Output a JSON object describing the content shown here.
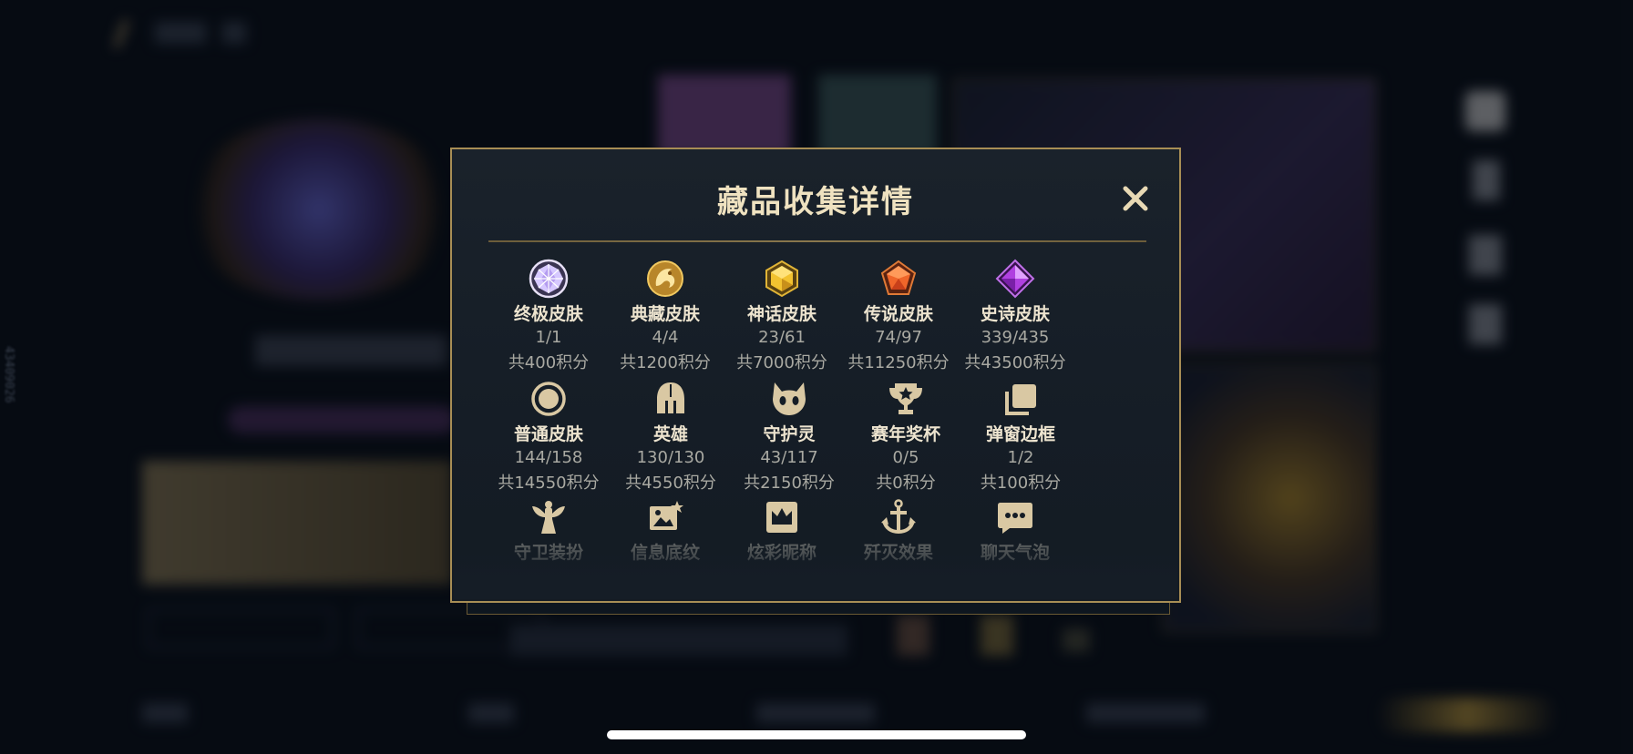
{
  "side_id": "43409026",
  "modal": {
    "title": "藏品收集详情",
    "close_label": "✕"
  },
  "colors": {
    "modal_border": "#a88e55",
    "title": "#efe2c0",
    "label": "#ede4cf",
    "muted": "#a9a9a2",
    "icon_beige": "#d9c8a3"
  },
  "categories": [
    {
      "name": "终极皮肤",
      "count": "1/1",
      "points": "共400积分",
      "icon": "ultimate-gem-icon"
    },
    {
      "name": "典藏皮肤",
      "count": "4/4",
      "points": "共1200积分",
      "icon": "dragon-emblem-icon"
    },
    {
      "name": "神话皮肤",
      "count": "23/61",
      "points": "共7000积分",
      "icon": "mythic-gem-icon"
    },
    {
      "name": "传说皮肤",
      "count": "74/97",
      "points": "共11250积分",
      "icon": "legendary-gem-icon"
    },
    {
      "name": "史诗皮肤",
      "count": "339/435",
      "points": "共43500积分",
      "icon": "epic-gem-icon"
    },
    {
      "name": "普通皮肤",
      "count": "144/158",
      "points": "共14550积分",
      "icon": "circle-icon"
    },
    {
      "name": "英雄",
      "count": "130/130",
      "points": "共4550积分",
      "icon": "helmet-icon"
    },
    {
      "name": "守护灵",
      "count": "43/117",
      "points": "共2150积分",
      "icon": "little-legend-icon"
    },
    {
      "name": "赛年奖杯",
      "count": "0/5",
      "points": "共0积分",
      "icon": "trophy-icon"
    },
    {
      "name": "弹窗边框",
      "count": "1/2",
      "points": "共100积分",
      "icon": "frame-stack-icon"
    },
    {
      "name": "守卫装扮",
      "icon": "ward-icon"
    },
    {
      "name": "信息底纹",
      "icon": "banner-image-icon"
    },
    {
      "name": "炫彩昵称",
      "icon": "crown-card-icon"
    },
    {
      "name": "歼灭效果",
      "icon": "anchor-icon"
    },
    {
      "name": "聊天气泡",
      "icon": "chat-bubble-icon"
    }
  ]
}
